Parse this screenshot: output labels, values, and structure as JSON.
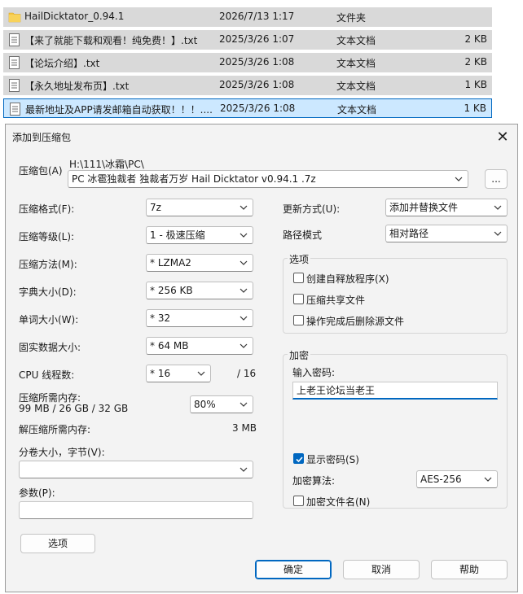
{
  "files": [
    {
      "name": "HailDicktator_0.94.1",
      "date": "2026/7/13 1:17",
      "type": "文件夹",
      "size": "",
      "icon": "folder-icon",
      "selected": false
    },
    {
      "name": "【来了就能下载和观看！纯免费！】.txt",
      "date": "2025/3/26 1:07",
      "type": "文本文档",
      "size": "2 KB",
      "icon": "text-file-icon",
      "selected": false
    },
    {
      "name": "【论坛介绍】.txt",
      "date": "2025/3/26 1:08",
      "type": "文本文档",
      "size": "2 KB",
      "icon": "text-file-icon",
      "selected": false
    },
    {
      "name": "【永久地址发布页】.txt",
      "date": "2025/3/26 1:08",
      "type": "文本文档",
      "size": "1 KB",
      "icon": "text-file-icon",
      "selected": false
    },
    {
      "name": "最新地址及APP请发邮箱自动获取！！！....",
      "date": "2025/3/26 1:08",
      "type": "文本文档",
      "size": "1 KB",
      "icon": "text-file-icon",
      "selected": true
    }
  ],
  "dialog": {
    "title": "添加到压缩包",
    "close": "✕",
    "archive_label": "压缩包(A)",
    "archive_path": "H:\\111\\冰霜\\PC\\",
    "archive_name": "PC 冰雹独裁者 独裁者万岁 Hail Dicktator  v0.94.1 .7z",
    "browse_label": "...",
    "format_label": "压缩格式(F):",
    "format_value": "7z",
    "level_label": "压缩等级(L):",
    "level_value": "1 - 极速压缩",
    "method_label": "压缩方法(M):",
    "method_value": "*  LZMA2",
    "dict_label": "字典大小(D):",
    "dict_value": "*  256 KB",
    "word_label": "单词大小(W):",
    "word_value": "*  32",
    "solid_label": "固实数据大小:",
    "solid_value": "*  64 MB",
    "cpu_label": "CPU 线程数:",
    "cpu_value": "*  16",
    "cpu_total": "/ 16",
    "mem_label": "压缩所需内存:",
    "mem_value": "99 MB / 26 GB / 32 GB",
    "mem_pct": "80%",
    "decomp_label": "解压缩所需内存:",
    "decomp_value": "3 MB",
    "split_label": "分卷大小，字节(V):",
    "split_value": "",
    "params_label": "参数(P):",
    "params_value": "",
    "options_btn": "选项",
    "update_label": "更新方式(U):",
    "update_value": "添加并替换文件",
    "path_label": "路径模式",
    "path_value": "相对路径",
    "options_group": "选项",
    "opt_sfx": "创建自释放程序(X)",
    "opt_shared": "压缩共享文件",
    "opt_delete": "操作完成后删除源文件",
    "encrypt_group": "加密",
    "pwd_label": "输入密码:",
    "pwd_value": "上老王论坛当老王",
    "show_pwd": "显示密码(S)",
    "enc_method_label": "加密算法:",
    "enc_method_value": "AES-256",
    "enc_names": "加密文件名(N)",
    "ok": "确定",
    "cancel": "取消",
    "help": "帮助"
  },
  "colors": {
    "accent": "#0067c0",
    "selection": "#cce8ff",
    "row": "#d9d9d9",
    "folder": "#f4c542"
  }
}
